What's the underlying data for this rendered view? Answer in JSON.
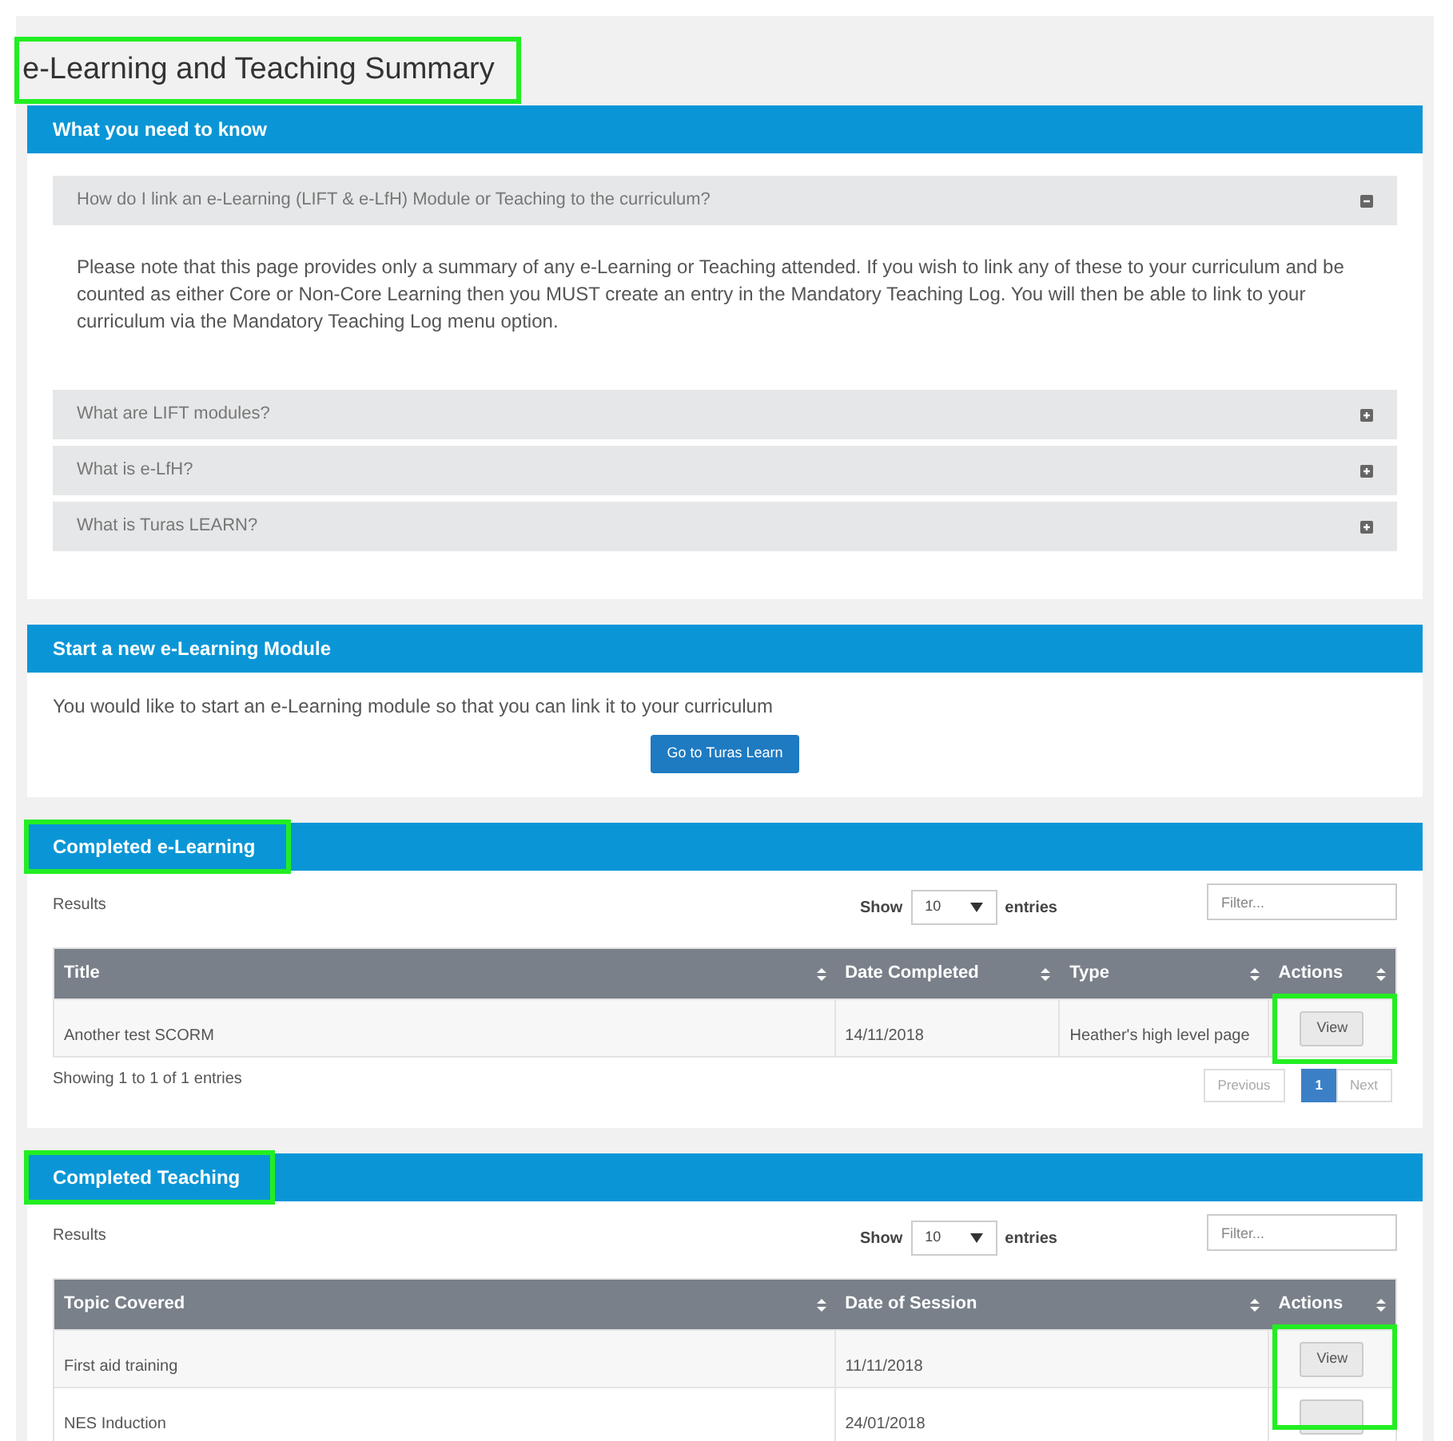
{
  "page_title": {
    "text": "e-Learning and Teaching Summary",
    "highlighted": true
  },
  "info_panel": {
    "title": "What you need to know",
    "items": [
      {
        "title": "How do I link an e-Learning (LIFT & e-LfH) Module or Teaching to the curriculum?",
        "expanded": true,
        "body": "Please note that this page provides only a summary of any e-Learning or Teaching attended. If you wish to link any of these to your curriculum and be counted as either Core or Non-Core Learning then you MUST create an entry in the Mandatory Teaching Log. You will then be able to link to your curriculum via the Mandatory Teaching Log menu option."
      },
      {
        "title": "What are LIFT modules?",
        "expanded": false
      },
      {
        "title": "What is e-LfH?",
        "expanded": false
      },
      {
        "title": "What is Turas LEARN?",
        "expanded": false
      }
    ]
  },
  "start_panel": {
    "title": "Start a new e-Learning Module",
    "text": "You would like to start an e-Learning module so that you can link it to your curriculum",
    "button": "Go to Turas Learn"
  },
  "tables": [
    {
      "title": "Completed e-Learning",
      "highlighted": true,
      "results_label": "Results",
      "show_label": "Show",
      "page_size": "10",
      "entries_label": "entries",
      "filter_placeholder": "Filter...",
      "columns": [
        "Title",
        "Date Completed",
        "Type",
        "Actions"
      ],
      "rows": [
        {
          "cells": [
            "Another test SCORM",
            "14/11/2018",
            "Heather's high level page"
          ],
          "action": "View"
        }
      ],
      "actions_highlighted": true,
      "info": "Showing 1 to 1 of 1 entries",
      "pagination": [
        {
          "label": "Previous",
          "selected": false
        },
        {
          "label": "1",
          "selected": true
        },
        {
          "label": "Next",
          "selected": false
        }
      ]
    },
    {
      "title": "Completed Teaching",
      "highlighted": true,
      "results_label": "Results",
      "show_label": "Show",
      "page_size": "10",
      "entries_label": "entries",
      "filter_placeholder": "Filter...",
      "columns": [
        "Topic Covered",
        "Date of Session",
        "Actions"
      ],
      "rows": [
        {
          "cells": [
            "First aid training",
            "11/11/2018"
          ],
          "action": "View"
        },
        {
          "cells": [
            "NES Induction",
            "24/01/2018"
          ]
        }
      ],
      "actions_highlighted": true
    }
  ]
}
